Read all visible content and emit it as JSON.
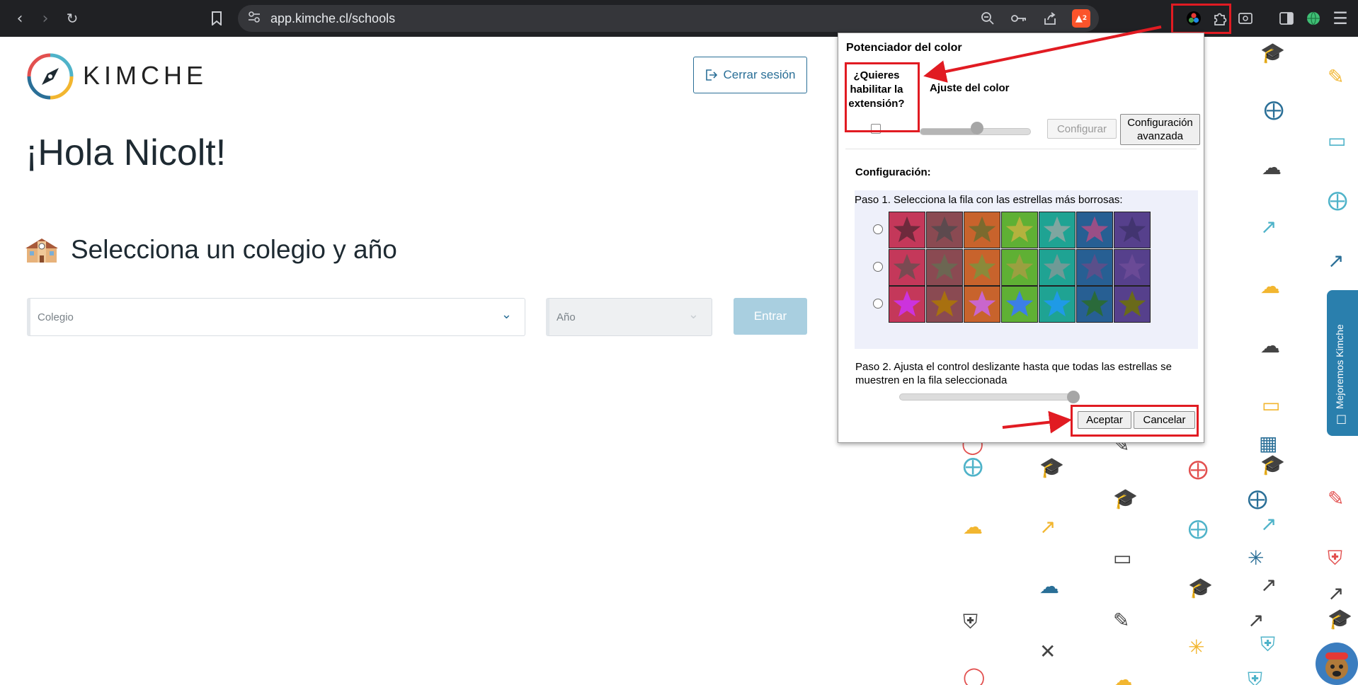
{
  "browser": {
    "url": "app.kimche.cl/schools",
    "shields_count": "2"
  },
  "app": {
    "brand": "KIMCHE",
    "logout_label": "Cerrar sesión",
    "greeting": "¡Hola Nicolt!",
    "select_title": "Selecciona un colegio y año",
    "school_placeholder": "Colegio",
    "year_placeholder": "Año",
    "enter_label": "Entrar",
    "feedback_label": "Mejoremos Kimche"
  },
  "extension": {
    "title": "Potenciador del color",
    "enable_question": "¿Quieres habilitar la extensión?",
    "color_adjust_label": "Ajuste del color",
    "configure_label": "Configurar",
    "advanced_label": "Configuración avanzada",
    "config_heading": "Configuración:",
    "step1": "Paso 1. Selecciona la fila con las estrellas más borrosas:",
    "step2": "Paso 2. Ajusta el control deslizante hasta que todas las estrellas se muestren en la fila seleccionada",
    "accept_label": "Aceptar",
    "cancel_label": "Cancelar",
    "enabled": false,
    "rows": [
      {
        "tiles": [
          {
            "bg": "#c4385a",
            "star": "#6e2a3c"
          },
          {
            "bg": "#8a4a52",
            "star": "#5c4a4e"
          },
          {
            "bg": "#c8632c",
            "star": "#7b6a2e"
          },
          {
            "bg": "#5fb034",
            "star": "#b4b23e"
          },
          {
            "bg": "#1fa393",
            "star": "#7fa6a0"
          },
          {
            "bg": "#275f93",
            "star": "#9a4f86"
          },
          {
            "bg": "#56408c",
            "star": "#423470"
          }
        ]
      },
      {
        "tiles": [
          {
            "bg": "#c4385a",
            "star": "#7a4a52"
          },
          {
            "bg": "#8a4a52",
            "star": "#6c6652"
          },
          {
            "bg": "#c8632c",
            "star": "#8a8a3a"
          },
          {
            "bg": "#5fb034",
            "star": "#9aa040"
          },
          {
            "bg": "#1fa393",
            "star": "#6f9a96"
          },
          {
            "bg": "#275f93",
            "star": "#5a4f8a"
          },
          {
            "bg": "#56408c",
            "star": "#6a4a96"
          }
        ]
      },
      {
        "tiles": [
          {
            "bg": "#c4385a",
            "star": "#cc33dd"
          },
          {
            "bg": "#8a4a52",
            "star": "#a87010"
          },
          {
            "bg": "#c8632c",
            "star": "#c966cc"
          },
          {
            "bg": "#5fb034",
            "star": "#3c7fe6"
          },
          {
            "bg": "#1fa393",
            "star": "#1f9ae6"
          },
          {
            "bg": "#275f93",
            "star": "#2a6a3a"
          },
          {
            "bg": "#56408c",
            "star": "#6a6a1a"
          }
        ]
      }
    ]
  },
  "colors": {
    "brand_blue": "#2a6f97",
    "annotation_red": "#e11b22",
    "feedback_tab": "#2a7fad"
  }
}
